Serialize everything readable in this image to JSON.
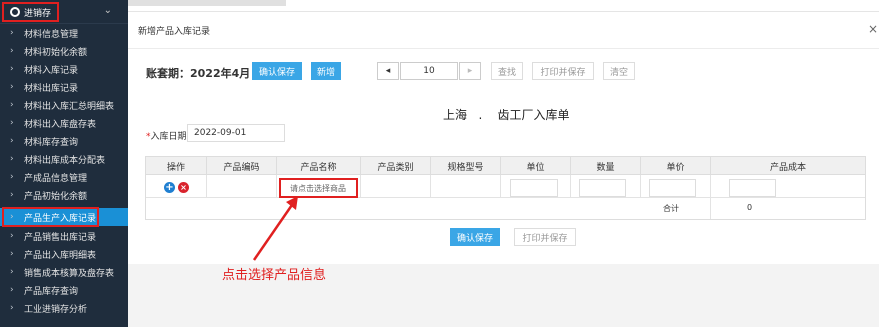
{
  "sidebar": {
    "group_label": "进销存",
    "items": [
      {
        "label": "材料信息管理"
      },
      {
        "label": "材料初始化余额"
      },
      {
        "label": "材料入库记录"
      },
      {
        "label": "材料出库记录"
      },
      {
        "label": "材料出入库汇总明细表"
      },
      {
        "label": "材料出入库盘存表"
      },
      {
        "label": "材料库存查询"
      },
      {
        "label": "材料出库成本分配表"
      },
      {
        "label": "产成品信息管理"
      },
      {
        "label": "产品初始化余额"
      },
      {
        "label": "产品生产入库记录"
      },
      {
        "label": "产品销售出库记录"
      },
      {
        "label": "产品出入库明细表"
      },
      {
        "label": "销售成本核算及盘存表"
      },
      {
        "label": "产品库存查询"
      },
      {
        "label": "工业进销存分析"
      }
    ]
  },
  "panel": {
    "title": "新增产品入库记录",
    "close": "×"
  },
  "toolbar": {
    "period": "账套期：2022年4月",
    "confirm_save": "确认保存",
    "add_new": "新增",
    "prev": "◂",
    "page_value": "10",
    "next": "▸",
    "search": "查找",
    "print_save": "打印并保存",
    "clear": "清空"
  },
  "doc": {
    "title": "上海   .    齿工厂入库单"
  },
  "form": {
    "date_label": "入库日期",
    "date_value": "2022-09-01"
  },
  "table": {
    "headers": [
      "操作",
      "产品编码",
      "产品名称",
      "产品类别",
      "规格型号",
      "单位",
      "数量",
      "单价",
      "产品成本"
    ],
    "product_placeholder": "请点击选择商品",
    "total_label": "合计",
    "total_value": "0"
  },
  "footer": {
    "confirm_save": "确认保存",
    "print_save": "打印并保存"
  },
  "annotation": {
    "text": "点击选择产品信息"
  },
  "colors": {
    "sidebar_bg": "#1f2d3d",
    "active_bg": "#1a90d6",
    "primary": "#3aa6e6",
    "highlight_red": "#e02020"
  }
}
